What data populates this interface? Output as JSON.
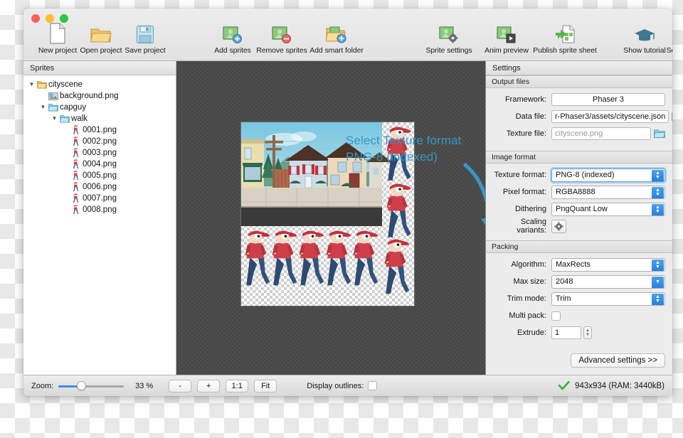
{
  "window": {
    "traffic_lights": [
      "close",
      "minimize",
      "maximize"
    ]
  },
  "toolbar": {
    "items": [
      {
        "label": "New project",
        "icon": "new-document-icon"
      },
      {
        "label": "Open project",
        "icon": "open-folder-icon"
      },
      {
        "label": "Save project",
        "icon": "floppy-disk-icon"
      },
      {
        "label": "Add sprites",
        "icon": "add-sprites-icon"
      },
      {
        "label": "Remove sprites",
        "icon": "remove-sprites-icon"
      },
      {
        "label": "Add smart folder",
        "icon": "add-smart-folder-icon"
      },
      {
        "label": "Sprite settings",
        "icon": "sprite-settings-icon"
      },
      {
        "label": "Anim preview",
        "icon": "anim-preview-icon"
      },
      {
        "label": "Publish sprite sheet",
        "icon": "publish-sprite-sheet-icon"
      },
      {
        "label": "Show tutorial",
        "icon": "graduation-cap-icon"
      },
      {
        "label": "Send feedback",
        "icon": "speech-bubble-icon"
      }
    ]
  },
  "sidebar": {
    "title": "Sprites",
    "tree": [
      {
        "label": "cityscene",
        "depth": 0,
        "twisty": "▼",
        "icon": "folder-yellow-icon"
      },
      {
        "label": "background.png",
        "depth": 1,
        "twisty": "",
        "icon": "image-file-icon"
      },
      {
        "label": "capguy",
        "depth": 1,
        "twisty": "▼",
        "icon": "folder-blue-icon"
      },
      {
        "label": "walk",
        "depth": 2,
        "twisty": "▼",
        "icon": "folder-blue-icon"
      },
      {
        "label": "0001.png",
        "depth": 3,
        "twisty": "",
        "icon": "sprite-thumb-icon"
      },
      {
        "label": "0002.png",
        "depth": 3,
        "twisty": "",
        "icon": "sprite-thumb-icon"
      },
      {
        "label": "0003.png",
        "depth": 3,
        "twisty": "",
        "icon": "sprite-thumb-icon"
      },
      {
        "label": "0004.png",
        "depth": 3,
        "twisty": "",
        "icon": "sprite-thumb-icon"
      },
      {
        "label": "0005.png",
        "depth": 3,
        "twisty": "",
        "icon": "sprite-thumb-icon"
      },
      {
        "label": "0006.png",
        "depth": 3,
        "twisty": "",
        "icon": "sprite-thumb-icon"
      },
      {
        "label": "0007.png",
        "depth": 3,
        "twisty": "",
        "icon": "sprite-thumb-icon"
      },
      {
        "label": "0008.png",
        "depth": 3,
        "twisty": "",
        "icon": "sprite-thumb-icon"
      }
    ]
  },
  "canvas": {
    "annotation_line1": "Select Texture format",
    "annotation_line2": "PNG-8 (indexed)",
    "annotation_color": "#3796c4"
  },
  "settings": {
    "title": "Settings",
    "output_files": {
      "header": "Output files",
      "framework_label": "Framework:",
      "framework_value": "Phaser 3",
      "data_file_label": "Data file:",
      "data_file_value": "r-Phaser3/assets/cityscene.json",
      "texture_file_label": "Texture file:",
      "texture_file_placeholder": "cityscene.png"
    },
    "image_format": {
      "header": "Image format",
      "texture_format_label": "Texture format:",
      "texture_format_value": "PNG-8 (indexed)",
      "pixel_format_label": "Pixel format:",
      "pixel_format_value": "RGBA8888",
      "dithering_label": "Dithering",
      "dithering_value": "PngQuant Low",
      "scaling_variants_label": "Scaling variants:"
    },
    "packing": {
      "header": "Packing",
      "algorithm_label": "Algorithm:",
      "algorithm_value": "MaxRects",
      "max_size_label": "Max size:",
      "max_size_value": "2048",
      "trim_mode_label": "Trim mode:",
      "trim_mode_value": "Trim",
      "multi_pack_label": "Multi pack:",
      "multi_pack_checked": false,
      "extrude_label": "Extrude:",
      "extrude_value": "1"
    },
    "advanced_button": "Advanced settings >>"
  },
  "statusbar": {
    "zoom_label": "Zoom:",
    "zoom_value": "33 %",
    "zoom_percent": 33,
    "minus_button": "-",
    "plus_button": "+",
    "one_to_one_button": "1:1",
    "fit_button": "Fit",
    "display_outlines_label": "Display outlines:",
    "display_outlines_checked": false,
    "size_info": "943x934 (RAM: 3440kB)"
  }
}
